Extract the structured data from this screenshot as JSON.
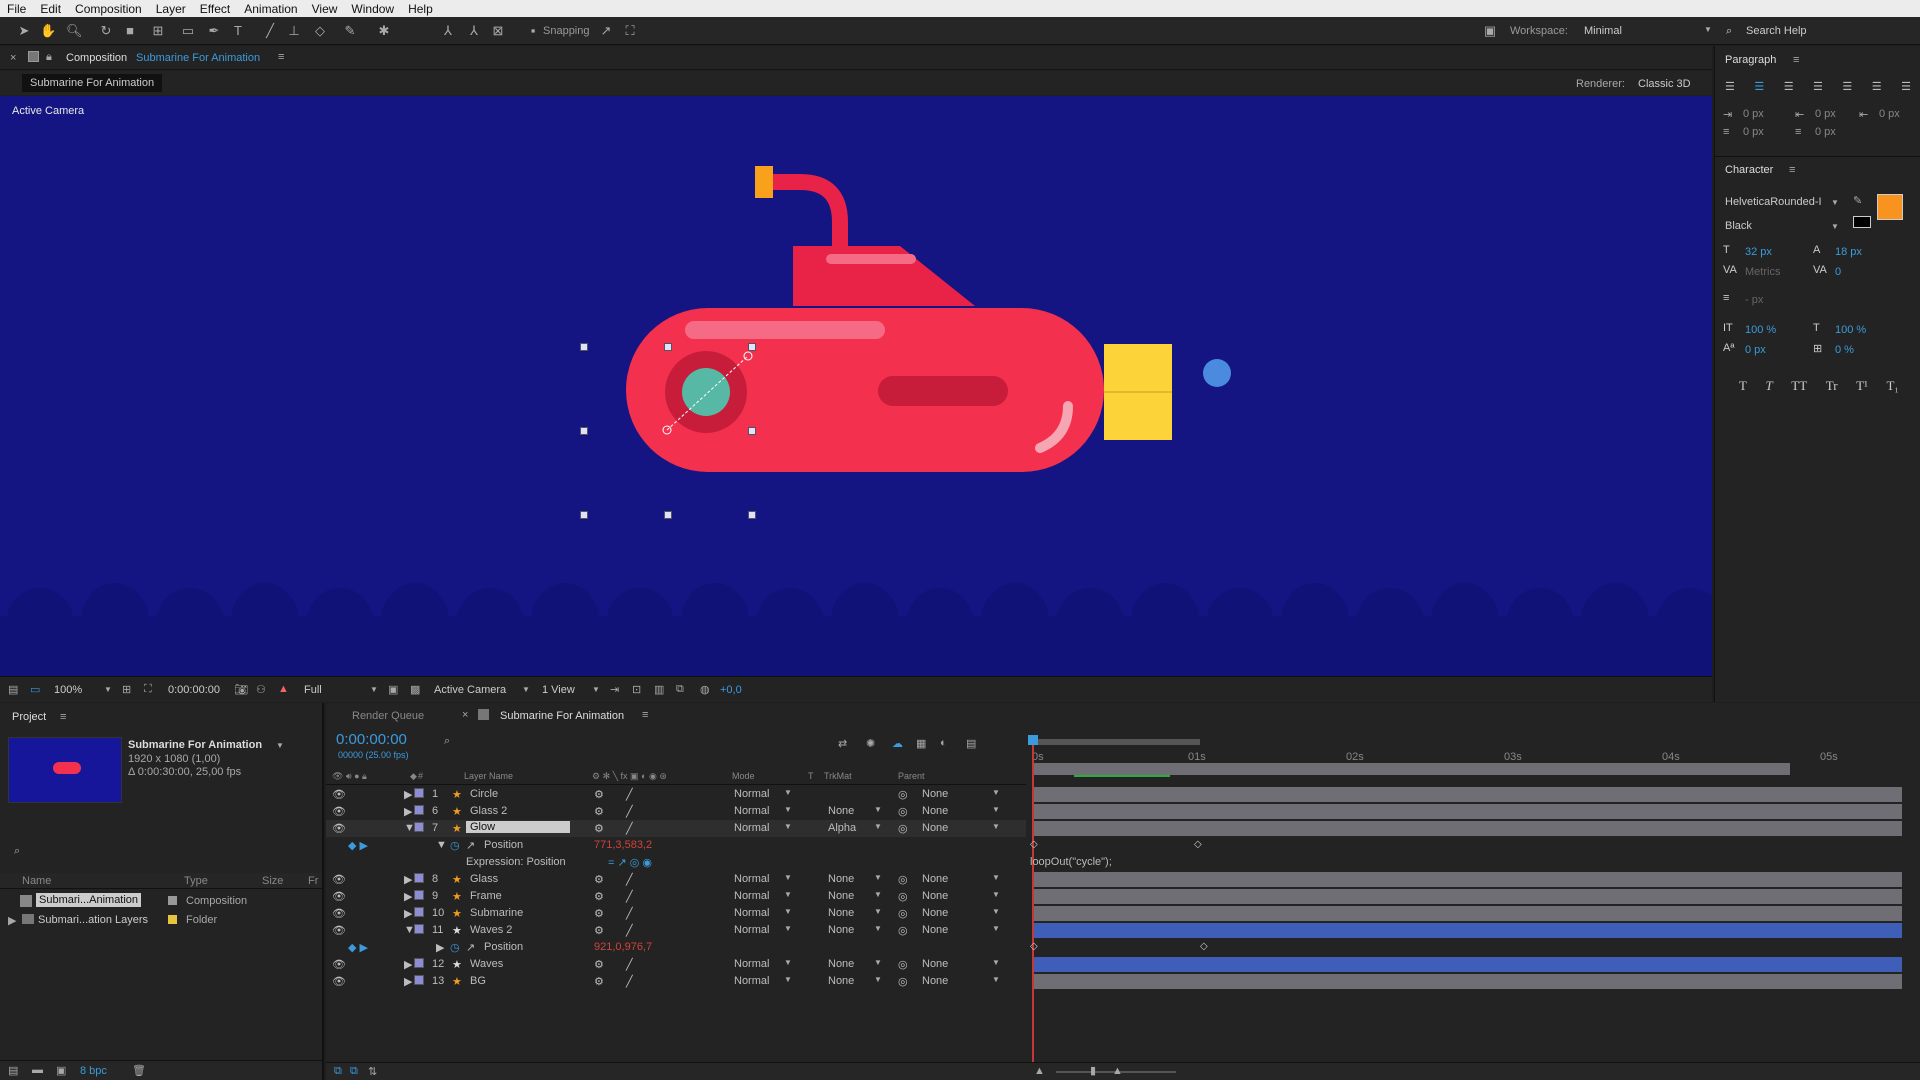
{
  "menu": [
    "File",
    "Edit",
    "Composition",
    "Layer",
    "Effect",
    "Animation",
    "View",
    "Window",
    "Help"
  ],
  "toolbar": {
    "snapping": "Snapping",
    "workspace_label": "Workspace:",
    "workspace_value": "Minimal",
    "search_help": "Search Help"
  },
  "comp_panel": {
    "tab_prefix": "Composition",
    "tab_name": "Submarine For Animation",
    "sub_tab": "Submarine For Animation",
    "renderer_label": "Renderer:",
    "renderer_value": "Classic 3D",
    "view_label": "Active Camera"
  },
  "viewer_bar": {
    "zoom": "100%",
    "time": "0:00:00:00",
    "resolution": "Full",
    "camera": "Active Camera",
    "views": "1 View",
    "exposure": "+0,0"
  },
  "paragraph": {
    "title": "Paragraph",
    "indent_left": "0 px",
    "indent_first": "0 px",
    "indent_right": "0 px",
    "space_before": "0 px",
    "space_after": "0 px"
  },
  "character": {
    "title": "Character",
    "font": "HelveticaRounded-I",
    "style": "Black",
    "font_size": "32 px",
    "leading": "18 px",
    "kerning": "Metrics",
    "tracking": "0",
    "stroke": "- px",
    "vscale": "100 %",
    "hscale": "100 %",
    "baseline": "0 px",
    "tsume": "0 %",
    "fill_color": "#f7931e"
  },
  "project": {
    "title": "Project",
    "comp_name": "Submarine For Animation",
    "comp_size": "1920 x 1080 (1,00)",
    "comp_duration": "Δ 0:00:30:00, 25,00 fps",
    "cols": [
      "Name",
      "Type",
      "Size",
      "Fr"
    ],
    "items": [
      {
        "name": "Submari...Animation",
        "type": "Composition"
      },
      {
        "name": "Submari...ation Layers",
        "type": "Folder"
      }
    ],
    "bpc": "8 bpc"
  },
  "timeline": {
    "tab_render": "Render Queue",
    "tab_comp": "Submarine For Animation",
    "timecode": "0:00:00:00",
    "frames": "00000 (25.00 fps)",
    "col_layer_name": "Layer Name",
    "col_mode": "Mode",
    "col_t": "T",
    "col_trkmat": "TrkMat",
    "col_parent": "Parent",
    "ruler": [
      "0s",
      "01s",
      "02s",
      "03s",
      "04s",
      "05s"
    ],
    "layers": [
      {
        "num": "1",
        "name": "Circle",
        "mode": "Normal",
        "trkmat": "",
        "parent": "None"
      },
      {
        "num": "6",
        "name": "Glass 2",
        "mode": "Normal",
        "trkmat": "None",
        "parent": "None"
      },
      {
        "num": "7",
        "name": "Glow",
        "mode": "Normal",
        "trkmat": "Alpha",
        "parent": "None"
      },
      {
        "num": "8",
        "name": "Glass",
        "mode": "Normal",
        "trkmat": "None",
        "parent": "None"
      },
      {
        "num": "9",
        "name": "Frame",
        "mode": "Normal",
        "trkmat": "None",
        "parent": "None"
      },
      {
        "num": "10",
        "name": "Submarine",
        "mode": "Normal",
        "trkmat": "None",
        "parent": "None"
      },
      {
        "num": "11",
        "name": "Waves 2",
        "mode": "Normal",
        "trkmat": "None",
        "parent": "None"
      },
      {
        "num": "12",
        "name": "Waves",
        "mode": "Normal",
        "trkmat": "None",
        "parent": "None"
      },
      {
        "num": "13",
        "name": "BG",
        "mode": "Normal",
        "trkmat": "None",
        "parent": "None"
      }
    ],
    "glow_position_label": "Position",
    "glow_position_value": "771,3,583,2",
    "expression_label": "Expression: Position",
    "expression_text": "loopOut(\"cycle\");",
    "waves2_position_label": "Position",
    "waves2_position_value": "921,0,976,7"
  },
  "colors": {
    "viewer_bg": "#141582",
    "sub_body": "#f4304f",
    "accent_blue": "#3c9bdc",
    "timecode": "#3c9bdc"
  }
}
